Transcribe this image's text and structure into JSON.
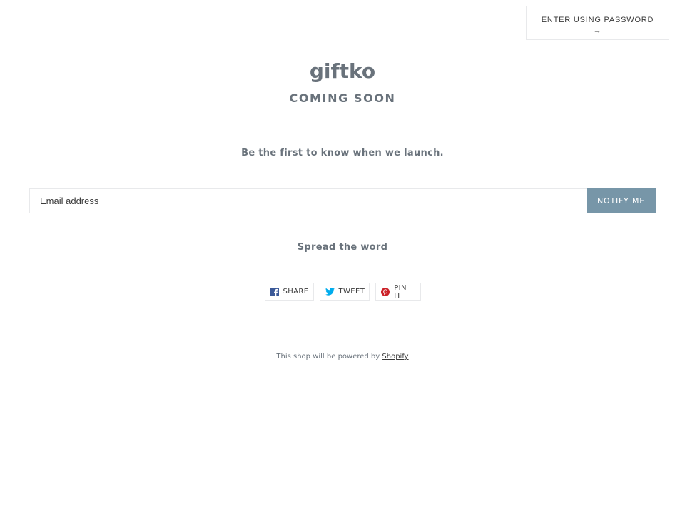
{
  "header": {
    "password_button_label": "ENTER USING PASSWORD",
    "password_button_arrow": "→"
  },
  "hero": {
    "shop_name": "giftko",
    "coming_soon": "COMING SOON",
    "tagline": "Be the first to know when we launch."
  },
  "signup": {
    "email_placeholder": "Email address",
    "email_value": "",
    "notify_label": "NOTIFY ME"
  },
  "share": {
    "heading": "Spread the word",
    "buttons": [
      {
        "label": "SHARE",
        "icon": "facebook-icon",
        "color": "#3b5998"
      },
      {
        "label": "TWEET",
        "icon": "twitter-icon",
        "color": "#00aced"
      },
      {
        "label": "PIN IT",
        "icon": "pinterest-icon",
        "color": "#cb2027"
      }
    ]
  },
  "footer": {
    "powered_text": "This shop will be powered by",
    "powered_link": "Shopify"
  },
  "colors": {
    "accent": "#7796a8",
    "text_muted": "#69727b",
    "border": "#e8e9eb"
  }
}
